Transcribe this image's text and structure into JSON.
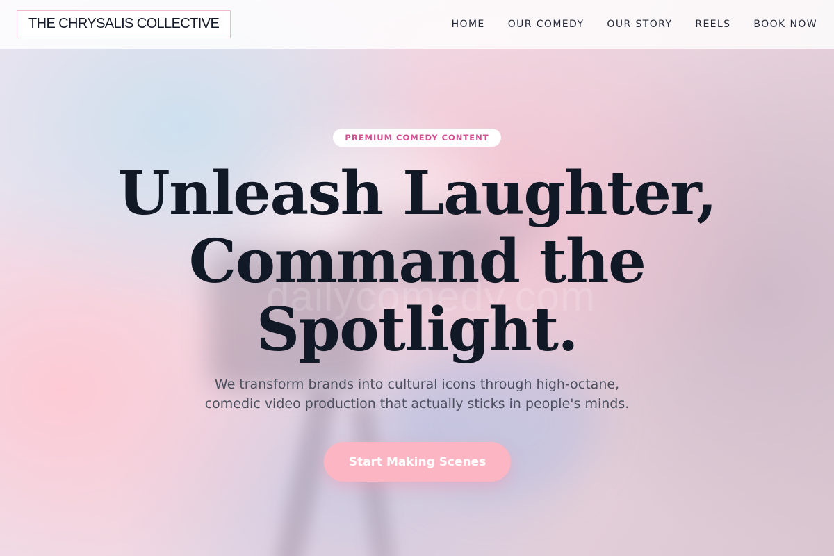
{
  "header": {
    "logo_text": "THE CHRYSALIS COLLECTIVE",
    "nav": [
      {
        "label": "HOME"
      },
      {
        "label": "OUR COMEDY"
      },
      {
        "label": "OUR STORY"
      },
      {
        "label": "REELS"
      },
      {
        "label": "BOOK NOW"
      }
    ]
  },
  "hero": {
    "badge": "PREMIUM COMEDY CONTENT",
    "headline_lines": [
      "Unleash Laughter,",
      "Command the",
      "Spotlight."
    ],
    "subtext_lines": [
      "We transform brands into cultural icons through high-octane,",
      "comedic video production that actually sticks in people's minds."
    ],
    "cta_label": "Start Making Scenes",
    "background_watermark": "dailycomedy.com"
  },
  "colors": {
    "accent_pink": "#fbb5c3",
    "badge_text": "#d14f8f",
    "heading": "#111826",
    "body_text": "#4c4f5e"
  }
}
